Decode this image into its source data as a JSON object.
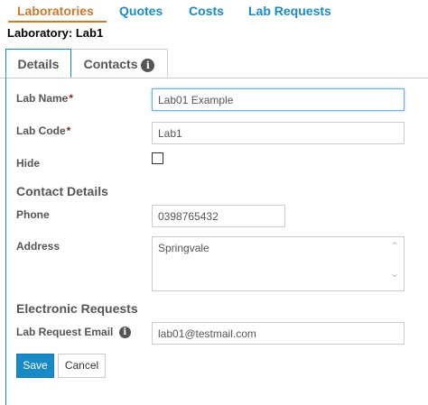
{
  "nav": {
    "items": [
      {
        "label": "Laboratories",
        "active": true
      },
      {
        "label": "Quotes",
        "active": false
      },
      {
        "label": "Costs",
        "active": false
      },
      {
        "label": "Lab Requests",
        "active": false
      }
    ]
  },
  "page_title": "Laboratory: Lab1",
  "tabs": [
    {
      "label": "Details",
      "active": true
    },
    {
      "label": "Contacts",
      "active": false,
      "icon": "info-icon"
    }
  ],
  "form": {
    "lab_name": {
      "label": "Lab Name",
      "required_mark": "*",
      "value": "Lab01 Example"
    },
    "lab_code": {
      "label": "Lab Code",
      "required_mark": "*",
      "value": "Lab1"
    },
    "hide": {
      "label": "Hide",
      "checked": false
    },
    "contact_section": "Contact Details",
    "phone": {
      "label": "Phone",
      "value": "0398765432"
    },
    "address": {
      "label": "Address",
      "value": "Springvale"
    },
    "electronic_section": "Electronic Requests",
    "lab_request_email": {
      "label": "Lab Request Email",
      "value": "lab01@testmail.com",
      "icon": "info-icon"
    }
  },
  "buttons": {
    "save": "Save",
    "cancel": "Cancel"
  },
  "icons": {
    "info": "i",
    "scroll_up": "⌃",
    "scroll_down": "⌄"
  },
  "colors": {
    "accent": "#1a8ac6",
    "active_nav": "#c97a2a",
    "required": "#8b1e1e"
  }
}
